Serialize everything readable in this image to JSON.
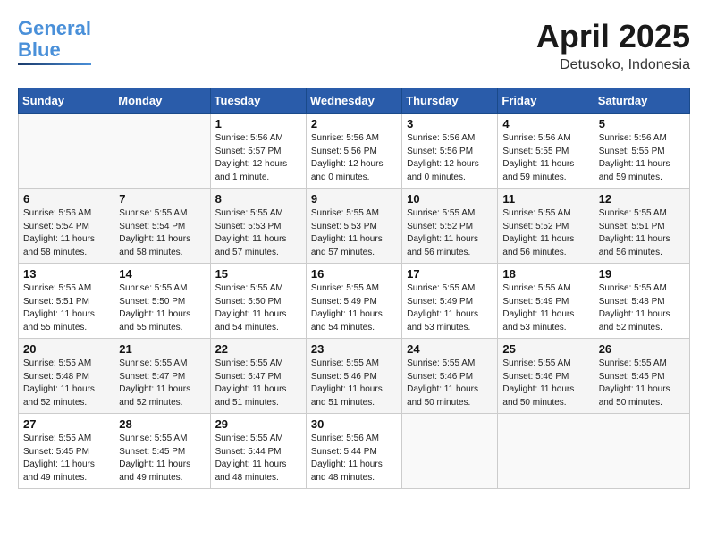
{
  "header": {
    "logo_line1": "General",
    "logo_line2": "Blue",
    "month_year": "April 2025",
    "location": "Detusoko, Indonesia"
  },
  "weekdays": [
    "Sunday",
    "Monday",
    "Tuesday",
    "Wednesday",
    "Thursday",
    "Friday",
    "Saturday"
  ],
  "weeks": [
    [
      {
        "day": "",
        "info": ""
      },
      {
        "day": "",
        "info": ""
      },
      {
        "day": "1",
        "info": "Sunrise: 5:56 AM\nSunset: 5:57 PM\nDaylight: 12 hours and 1 minute."
      },
      {
        "day": "2",
        "info": "Sunrise: 5:56 AM\nSunset: 5:56 PM\nDaylight: 12 hours and 0 minutes."
      },
      {
        "day": "3",
        "info": "Sunrise: 5:56 AM\nSunset: 5:56 PM\nDaylight: 12 hours and 0 minutes."
      },
      {
        "day": "4",
        "info": "Sunrise: 5:56 AM\nSunset: 5:55 PM\nDaylight: 11 hours and 59 minutes."
      },
      {
        "day": "5",
        "info": "Sunrise: 5:56 AM\nSunset: 5:55 PM\nDaylight: 11 hours and 59 minutes."
      }
    ],
    [
      {
        "day": "6",
        "info": "Sunrise: 5:56 AM\nSunset: 5:54 PM\nDaylight: 11 hours and 58 minutes."
      },
      {
        "day": "7",
        "info": "Sunrise: 5:55 AM\nSunset: 5:54 PM\nDaylight: 11 hours and 58 minutes."
      },
      {
        "day": "8",
        "info": "Sunrise: 5:55 AM\nSunset: 5:53 PM\nDaylight: 11 hours and 57 minutes."
      },
      {
        "day": "9",
        "info": "Sunrise: 5:55 AM\nSunset: 5:53 PM\nDaylight: 11 hours and 57 minutes."
      },
      {
        "day": "10",
        "info": "Sunrise: 5:55 AM\nSunset: 5:52 PM\nDaylight: 11 hours and 56 minutes."
      },
      {
        "day": "11",
        "info": "Sunrise: 5:55 AM\nSunset: 5:52 PM\nDaylight: 11 hours and 56 minutes."
      },
      {
        "day": "12",
        "info": "Sunrise: 5:55 AM\nSunset: 5:51 PM\nDaylight: 11 hours and 56 minutes."
      }
    ],
    [
      {
        "day": "13",
        "info": "Sunrise: 5:55 AM\nSunset: 5:51 PM\nDaylight: 11 hours and 55 minutes."
      },
      {
        "day": "14",
        "info": "Sunrise: 5:55 AM\nSunset: 5:50 PM\nDaylight: 11 hours and 55 minutes."
      },
      {
        "day": "15",
        "info": "Sunrise: 5:55 AM\nSunset: 5:50 PM\nDaylight: 11 hours and 54 minutes."
      },
      {
        "day": "16",
        "info": "Sunrise: 5:55 AM\nSunset: 5:49 PM\nDaylight: 11 hours and 54 minutes."
      },
      {
        "day": "17",
        "info": "Sunrise: 5:55 AM\nSunset: 5:49 PM\nDaylight: 11 hours and 53 minutes."
      },
      {
        "day": "18",
        "info": "Sunrise: 5:55 AM\nSunset: 5:49 PM\nDaylight: 11 hours and 53 minutes."
      },
      {
        "day": "19",
        "info": "Sunrise: 5:55 AM\nSunset: 5:48 PM\nDaylight: 11 hours and 52 minutes."
      }
    ],
    [
      {
        "day": "20",
        "info": "Sunrise: 5:55 AM\nSunset: 5:48 PM\nDaylight: 11 hours and 52 minutes."
      },
      {
        "day": "21",
        "info": "Sunrise: 5:55 AM\nSunset: 5:47 PM\nDaylight: 11 hours and 52 minutes."
      },
      {
        "day": "22",
        "info": "Sunrise: 5:55 AM\nSunset: 5:47 PM\nDaylight: 11 hours and 51 minutes."
      },
      {
        "day": "23",
        "info": "Sunrise: 5:55 AM\nSunset: 5:46 PM\nDaylight: 11 hours and 51 minutes."
      },
      {
        "day": "24",
        "info": "Sunrise: 5:55 AM\nSunset: 5:46 PM\nDaylight: 11 hours and 50 minutes."
      },
      {
        "day": "25",
        "info": "Sunrise: 5:55 AM\nSunset: 5:46 PM\nDaylight: 11 hours and 50 minutes."
      },
      {
        "day": "26",
        "info": "Sunrise: 5:55 AM\nSunset: 5:45 PM\nDaylight: 11 hours and 50 minutes."
      }
    ],
    [
      {
        "day": "27",
        "info": "Sunrise: 5:55 AM\nSunset: 5:45 PM\nDaylight: 11 hours and 49 minutes."
      },
      {
        "day": "28",
        "info": "Sunrise: 5:55 AM\nSunset: 5:45 PM\nDaylight: 11 hours and 49 minutes."
      },
      {
        "day": "29",
        "info": "Sunrise: 5:55 AM\nSunset: 5:44 PM\nDaylight: 11 hours and 48 minutes."
      },
      {
        "day": "30",
        "info": "Sunrise: 5:56 AM\nSunset: 5:44 PM\nDaylight: 11 hours and 48 minutes."
      },
      {
        "day": "",
        "info": ""
      },
      {
        "day": "",
        "info": ""
      },
      {
        "day": "",
        "info": ""
      }
    ]
  ]
}
